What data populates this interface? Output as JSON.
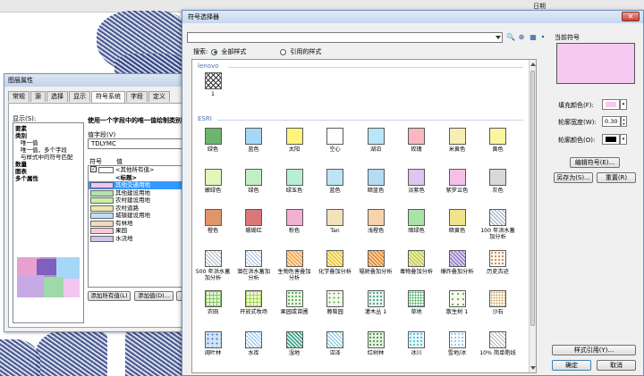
{
  "topbar": {
    "item_a": "日期"
  },
  "layer_dialog": {
    "title": "图层属性",
    "tabs": [
      "常规",
      "源",
      "选择",
      "显示",
      "符号系统",
      "字段",
      "定义"
    ],
    "active_tab_index": 4,
    "show_label": "显示(S):",
    "tree": [
      {
        "text": "要素",
        "bold": true,
        "indent": 0
      },
      {
        "text": "类别",
        "bold": true,
        "indent": 0
      },
      {
        "text": "唯一值",
        "bold": false,
        "indent": 1
      },
      {
        "text": "唯一值，多个字段",
        "bold": false,
        "indent": 1
      },
      {
        "text": "与样式中的符号匹配",
        "bold": false,
        "indent": 1
      },
      {
        "text": "数量",
        "bold": true,
        "indent": 0
      },
      {
        "text": "图表",
        "bold": true,
        "indent": 0
      },
      {
        "text": "多个属性",
        "bold": true,
        "indent": 0
      }
    ],
    "heading": "使用一个字段中的唯一值绘制类别",
    "value_field_label": "值字段(V)",
    "value_field": "TDLYMC",
    "col_symbol": "符号",
    "col_value": "值",
    "rows": [
      {
        "label": "<其他所有值>",
        "color": "#ffffff",
        "check": true
      },
      {
        "label": "<标题>",
        "color": "",
        "heading": true
      },
      {
        "label": "其他交通用地",
        "color": "#f3c4ef",
        "selected": true
      },
      {
        "label": "其他建设用地",
        "color": "#b0e3b0"
      },
      {
        "label": "农村建设用地",
        "color": "#c6f0a8"
      },
      {
        "label": "农村道路",
        "color": "#e9e7b4"
      },
      {
        "label": "城镇建设用地",
        "color": "#b9e2f5"
      },
      {
        "label": "有林地",
        "color": "#f2d9bf"
      },
      {
        "label": "果园",
        "color": "#f7c9d7"
      },
      {
        "label": "水浇地",
        "color": "#cfc4ee"
      }
    ],
    "btn_add_all": "添加所有值(L)",
    "btn_add": "添加值(D)..."
  },
  "selector": {
    "title": "符号选择器",
    "close_label": "✕",
    "search_value": "",
    "scope_label": "搜索:",
    "scope_all": "全部样式",
    "scope_ref": "引用的样式",
    "group1": "lenovo",
    "group2": "ESRI",
    "lenovo_items": [
      {
        "name": "1",
        "pattern": "cross"
      }
    ],
    "items": [
      {
        "name": "绿色",
        "color": "#6cb56c"
      },
      {
        "name": "蓝色",
        "color": "#a6d7f5"
      },
      {
        "name": "太阳",
        "color": "#fdf57a"
      },
      {
        "name": "空心",
        "color": "#ffffff"
      },
      {
        "name": "湖泊",
        "color": "#b9e6f8"
      },
      {
        "name": "玫瑰",
        "color": "#f9b8c0"
      },
      {
        "name": "米黄色",
        "color": "#f6efb3"
      },
      {
        "name": "黄色",
        "color": "#fbf5a0"
      },
      {
        "name": "嫩绿色",
        "color": "#dff7b8"
      },
      {
        "name": "绿色",
        "color": "#c3eec0"
      },
      {
        "name": "绿玉色",
        "color": "#b7efd6"
      },
      {
        "name": "蓝色",
        "color": "#bde4f7"
      },
      {
        "name": "暗蓝色",
        "color": "#b4dcf3"
      },
      {
        "name": "淡紫色",
        "color": "#dcc7f0"
      },
      {
        "name": "紫罗兰色",
        "color": "#f4c0ea"
      },
      {
        "name": "灰色",
        "color": "#d9d9d9"
      },
      {
        "name": "橙色",
        "color": "#e3956a"
      },
      {
        "name": "珊瑚红",
        "color": "#d9777a"
      },
      {
        "name": "粉色",
        "color": "#f2b0d3"
      },
      {
        "name": "Tan",
        "color": "#f4e2bd"
      },
      {
        "name": "浅橙色",
        "color": "#f7d3ad"
      },
      {
        "name": "暗绿色",
        "color": "#a9e3a6"
      },
      {
        "name": "暗黄色",
        "color": "#efe48c"
      },
      {
        "name": "100 年洪水蓄加分析",
        "pattern": "hatch-grey"
      },
      {
        "name": "500 年洪水蓄加分析",
        "pattern": "hatch-grey2"
      },
      {
        "name": "潜在洪水蓄加分析",
        "pattern": "hatch-blue"
      },
      {
        "name": "生物危害叠加分析",
        "pattern": "hatch-orange"
      },
      {
        "name": "化学叠加分析",
        "pattern": "hatch-yellow"
      },
      {
        "name": "辐射叠加分析",
        "pattern": "hatch-red"
      },
      {
        "name": "毒物叠加分析",
        "pattern": "hatch-ygreen"
      },
      {
        "name": "爆炸叠加分析",
        "pattern": "hatch-purple"
      },
      {
        "name": "历史古迹",
        "pattern": "dots-brown"
      },
      {
        "name": "农田",
        "pattern": "grid-green"
      },
      {
        "name": "开放式牧场",
        "pattern": "grid-lime"
      },
      {
        "name": "果园或苗圃",
        "pattern": "dots-green"
      },
      {
        "name": "葡萄园",
        "pattern": "dots-green2"
      },
      {
        "name": "灌木丛 1",
        "pattern": "dots-teal"
      },
      {
        "name": "草地",
        "pattern": "dots-grass"
      },
      {
        "name": "散生树 1",
        "pattern": "dots-tree"
      },
      {
        "name": "沙石",
        "pattern": "dots-sand"
      },
      {
        "name": "阔叶林",
        "pattern": "blobs-blue"
      },
      {
        "name": "水库",
        "pattern": "hatch-water"
      },
      {
        "name": "湿地",
        "pattern": "hatch-wet"
      },
      {
        "name": "沼泽",
        "pattern": "hatch-marsh"
      },
      {
        "name": "红树林",
        "pattern": "dots-mangrove"
      },
      {
        "name": "冰川",
        "pattern": "blobs-cyan"
      },
      {
        "name": "雪地/冰",
        "pattern": "dots-snow"
      },
      {
        "name": "10% 简单剔线",
        "pattern": "hatch-thin"
      }
    ],
    "current_label": "当前符号",
    "fill_color_label": "填充颜色(F):",
    "outline_width_label": "轮廓宽度(W):",
    "outline_width_value": "0.30",
    "outline_color_label": "轮廓颜色(O):",
    "btn_edit": "编辑符号(E)...",
    "btn_save_as": "另存为(S)...",
    "btn_reset": "重置(R)",
    "btn_style_ref": "样式引用(Y)...",
    "btn_ok": "确定",
    "btn_cancel": "取消",
    "fill_color": "#f6c8f2",
    "outline_color": "#000000"
  }
}
